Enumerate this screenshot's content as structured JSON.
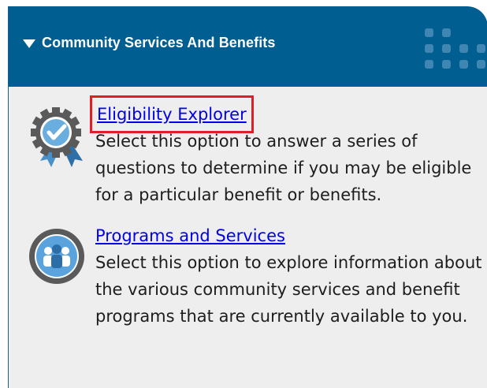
{
  "header": {
    "title": "Community Services And Benefits"
  },
  "items": [
    {
      "link": "Eligibility Explorer",
      "description": "Select this option to answer a series of questions to determine if you may be eligible for a particular benefit or benefits.",
      "icon": "badge-check-icon"
    },
    {
      "link": "Programs and Services",
      "description": "Select this option to explore information about the various community services and benefit programs that are currently available to you.",
      "icon": "people-group-icon"
    }
  ],
  "colors": {
    "header_bg": "#005e91",
    "panel_bg": "#eeeeee",
    "link": "#0000ee",
    "highlight": "#e01e26"
  }
}
